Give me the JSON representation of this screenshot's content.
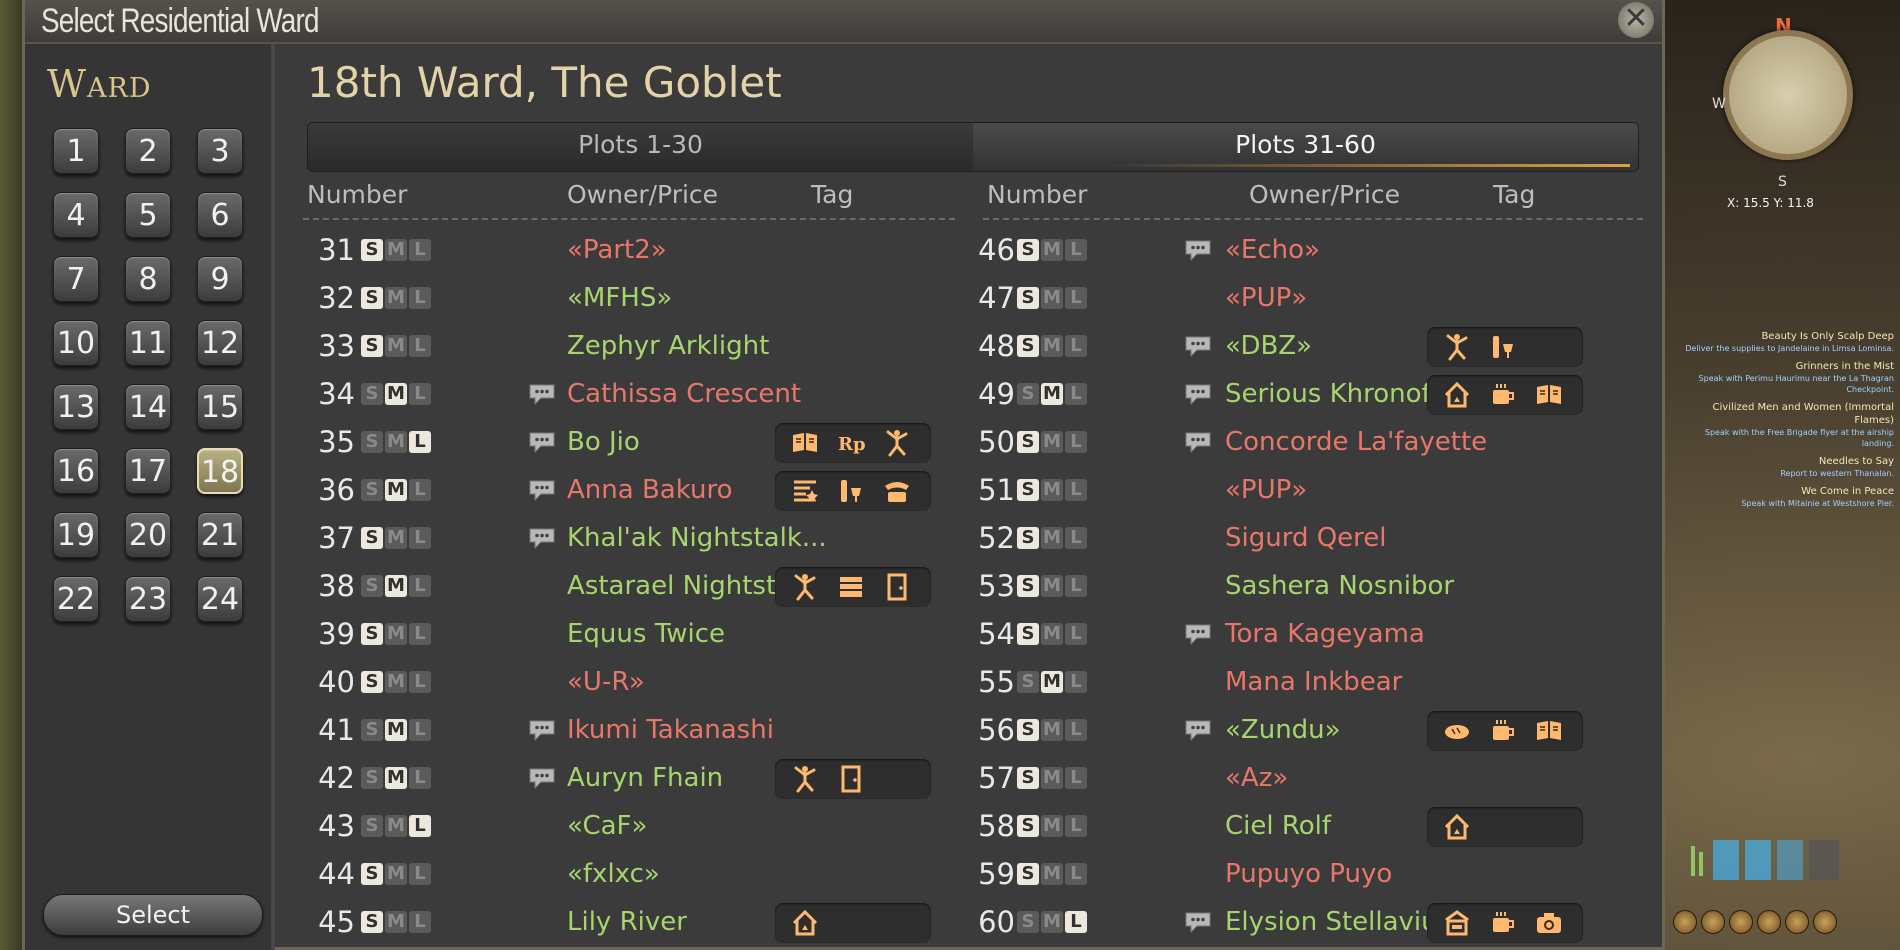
{
  "window": {
    "title": "Select Residential Ward",
    "close_symbol": "✕"
  },
  "sidebar": {
    "heading": "Ward",
    "wards": [
      "1",
      "2",
      "3",
      "4",
      "5",
      "6",
      "7",
      "8",
      "9",
      "10",
      "11",
      "12",
      "13",
      "14",
      "15",
      "16",
      "17",
      "18",
      "19",
      "20",
      "21",
      "22",
      "23",
      "24"
    ],
    "selected_ward": "18",
    "select_label": "Select"
  },
  "main": {
    "ward_title": "18th Ward, The Goblet",
    "tabs": [
      {
        "label": "Plots 1-30",
        "active": false
      },
      {
        "label": "Plots 31-60",
        "active": true
      }
    ],
    "columns": {
      "number": "Number",
      "owner": "Owner/Price",
      "tag": "Tag"
    },
    "colors": {
      "free_company_green": "#a6d56e",
      "individual_red": "#e8776a"
    },
    "left_plots": [
      {
        "num": "31",
        "size": "S",
        "chat": false,
        "owner": "«Part2»",
        "color": "r",
        "tags": []
      },
      {
        "num": "32",
        "size": "S",
        "chat": false,
        "owner": "«MFHS»",
        "color": "g",
        "tags": []
      },
      {
        "num": "33",
        "size": "S",
        "chat": false,
        "owner": "Zephyr Arklight",
        "color": "g",
        "tags": []
      },
      {
        "num": "34",
        "size": "M",
        "chat": true,
        "owner": "Cathissa Crescent",
        "color": "r",
        "tags": []
      },
      {
        "num": "35",
        "size": "L",
        "chat": true,
        "owner": "Bo Jio",
        "color": "g",
        "tags": [
          "book-icon",
          "roleplay-icon",
          "dancer-icon"
        ]
      },
      {
        "num": "36",
        "size": "M",
        "chat": true,
        "owner": "Anna Bakuro",
        "color": "r",
        "tags": [
          "stage-icon",
          "bar-icon",
          "phone-icon"
        ]
      },
      {
        "num": "37",
        "size": "S",
        "chat": true,
        "owner": "Khal'ak Nightstalk...",
        "color": "g",
        "tags": []
      },
      {
        "num": "38",
        "size": "M",
        "chat": false,
        "owner": "Astarael Nightstal...",
        "color": "g",
        "tags": [
          "dancer-icon",
          "library-icon",
          "door-icon"
        ]
      },
      {
        "num": "39",
        "size": "S",
        "chat": false,
        "owner": "Equus Twice",
        "color": "g",
        "tags": []
      },
      {
        "num": "40",
        "size": "S",
        "chat": false,
        "owner": "«U-R»",
        "color": "r",
        "tags": []
      },
      {
        "num": "41",
        "size": "M",
        "chat": true,
        "owner": "Ikumi Takanashi",
        "color": "r",
        "tags": []
      },
      {
        "num": "42",
        "size": "M",
        "chat": true,
        "owner": "Auryn Fhain",
        "color": "g",
        "tags": [
          "dancer-icon",
          "door-icon"
        ]
      },
      {
        "num": "43",
        "size": "L",
        "chat": false,
        "owner": "«CaF»",
        "color": "g",
        "tags": []
      },
      {
        "num": "44",
        "size": "S",
        "chat": false,
        "owner": "«fxlxc»",
        "color": "g",
        "tags": []
      },
      {
        "num": "45",
        "size": "S",
        "chat": false,
        "owner": "Lily River",
        "color": "g",
        "tags": [
          "house-icon"
        ]
      }
    ],
    "right_plots": [
      {
        "num": "46",
        "size": "S",
        "chat": true,
        "owner": "«Echo»",
        "color": "r",
        "tags": []
      },
      {
        "num": "47",
        "size": "S",
        "chat": false,
        "owner": "«PUP»",
        "color": "r",
        "tags": []
      },
      {
        "num": "48",
        "size": "S",
        "chat": true,
        "owner": "«DBZ»",
        "color": "g",
        "tags": [
          "dancer-icon",
          "bar-icon"
        ]
      },
      {
        "num": "49",
        "size": "M",
        "chat": true,
        "owner": "Serious Khronofild",
        "color": "g",
        "tags": [
          "house-icon",
          "cafe-icon",
          "book-icon"
        ]
      },
      {
        "num": "50",
        "size": "S",
        "chat": true,
        "owner": "Concorde La'fayette",
        "color": "r",
        "tags": []
      },
      {
        "num": "51",
        "size": "S",
        "chat": false,
        "owner": "«PUP»",
        "color": "r",
        "tags": []
      },
      {
        "num": "52",
        "size": "S",
        "chat": false,
        "owner": "Sigurd Qerel",
        "color": "r",
        "tags": []
      },
      {
        "num": "53",
        "size": "S",
        "chat": false,
        "owner": "Sashera Nosnibor",
        "color": "g",
        "tags": []
      },
      {
        "num": "54",
        "size": "S",
        "chat": true,
        "owner": "Tora Kageyama",
        "color": "r",
        "tags": []
      },
      {
        "num": "55",
        "size": "M",
        "chat": false,
        "owner": "Mana Inkbear",
        "color": "r",
        "tags": []
      },
      {
        "num": "56",
        "size": "S",
        "chat": true,
        "owner": "«Zundu»",
        "color": "g",
        "tags": [
          "bread-icon",
          "cafe-icon",
          "book-icon"
        ]
      },
      {
        "num": "57",
        "size": "S",
        "chat": false,
        "owner": "«Az»",
        "color": "r",
        "tags": []
      },
      {
        "num": "58",
        "size": "S",
        "chat": false,
        "owner": "Ciel Rolf",
        "color": "g",
        "tags": [
          "house-icon"
        ]
      },
      {
        "num": "59",
        "size": "S",
        "chat": false,
        "owner": "Pupuyo Puyo",
        "color": "r",
        "tags": []
      },
      {
        "num": "60",
        "size": "L",
        "chat": true,
        "owner": "Elysion Stellavium",
        "color": "g",
        "tags": [
          "shop-icon",
          "cafe-icon",
          "camera-icon"
        ]
      }
    ]
  },
  "hud": {
    "map_north": "N",
    "map_south": "S",
    "map_west": "W",
    "coordinates": "X: 15.5 Y: 11.8",
    "quests": [
      {
        "title": "Beauty Is Only Scalp Deep",
        "desc": "Deliver the supplies to Jandelaine in Limsa Lominsa."
      },
      {
        "title": "Grinners in the Mist",
        "desc": "Speak with Perimu Haurimu near the La Thagran Checkpoint."
      },
      {
        "title": "Civilized Men and Women (Immortal Flames)",
        "desc": "Speak with the Free Brigade flyer at the airship landing."
      },
      {
        "title": "Needles to Say",
        "desc": "Report to western Thanalan."
      },
      {
        "title": "We Come in Peace",
        "desc": "Speak with Mitainie at Westshore Pier."
      }
    ]
  }
}
